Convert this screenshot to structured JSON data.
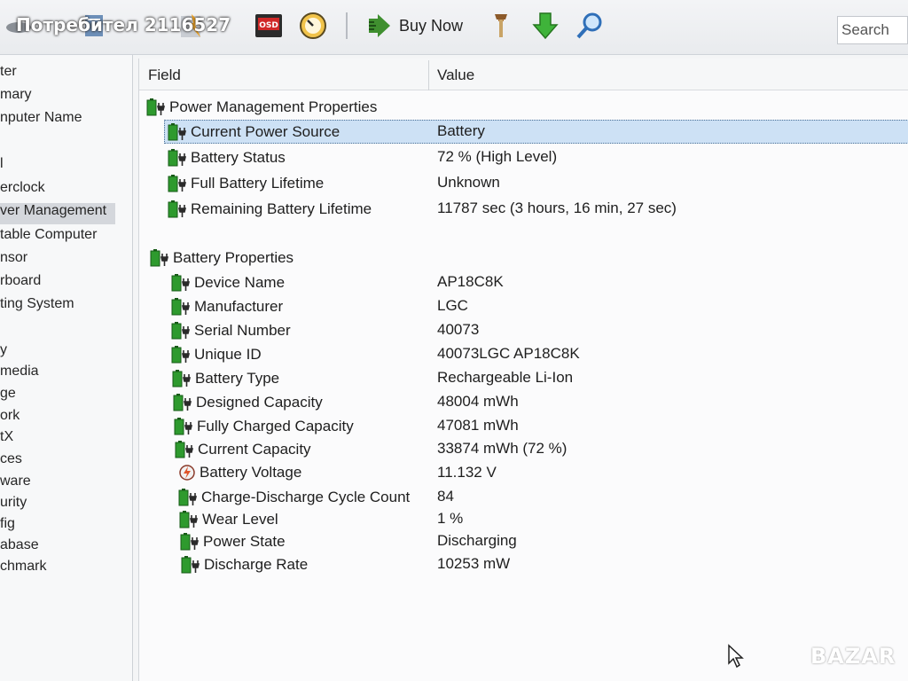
{
  "watermark_user": "Потребител 2116527",
  "brand_watermark": "BAZAR",
  "toolbar": {
    "osd_label": "OSD",
    "buy_now_label": "Buy Now",
    "search_placeholder": "Search"
  },
  "nav": {
    "items": [
      "ter",
      "mary",
      "nputer Name",
      "l",
      "erclock",
      "ver Management",
      "table Computer",
      "nsor",
      "rboard",
      "ting System",
      "y",
      "media",
      "ge",
      "ork",
      "tX",
      "ces",
      "ware",
      "urity",
      "fig",
      "abase",
      "chmark"
    ],
    "selected_index": 5
  },
  "columns": {
    "field": "Field",
    "value": "Value"
  },
  "groups": [
    {
      "title": "Power Management Properties",
      "rows": [
        {
          "field": "Current Power Source",
          "value": "Battery"
        },
        {
          "field": "Battery Status",
          "value": "72 % (High Level)"
        },
        {
          "field": "Full Battery Lifetime",
          "value": "Unknown"
        },
        {
          "field": "Remaining Battery Lifetime",
          "value": "11787 sec (3 hours, 16 min, 27 sec)"
        }
      ]
    },
    {
      "title": "Battery Properties",
      "rows": [
        {
          "field": "Device Name",
          "value": "AP18C8K"
        },
        {
          "field": "Manufacturer",
          "value": "LGC"
        },
        {
          "field": "Serial Number",
          "value": "40073"
        },
        {
          "field": "Unique ID",
          "value": "40073LGC AP18C8K"
        },
        {
          "field": "Battery Type",
          "value": "Rechargeable Li-Ion"
        },
        {
          "field": "Designed Capacity",
          "value": "48004 mWh"
        },
        {
          "field": "Fully Charged Capacity",
          "value": "47081 mWh"
        },
        {
          "field": "Current Capacity",
          "value": "33874 mWh  (72 %)"
        },
        {
          "field": "Battery Voltage",
          "value": "11.132 V"
        },
        {
          "field": "Charge-Discharge Cycle Count",
          "value": "84"
        },
        {
          "field": "Wear Level",
          "value": "1 %"
        },
        {
          "field": "Power State",
          "value": "Discharging"
        },
        {
          "field": "Discharge Rate",
          "value": "10253 mW"
        }
      ]
    }
  ],
  "colors": {
    "battery_green": "#2e9a2e",
    "selection_blue": "#cde1f5",
    "nav_selected": "#d4d7dc"
  }
}
